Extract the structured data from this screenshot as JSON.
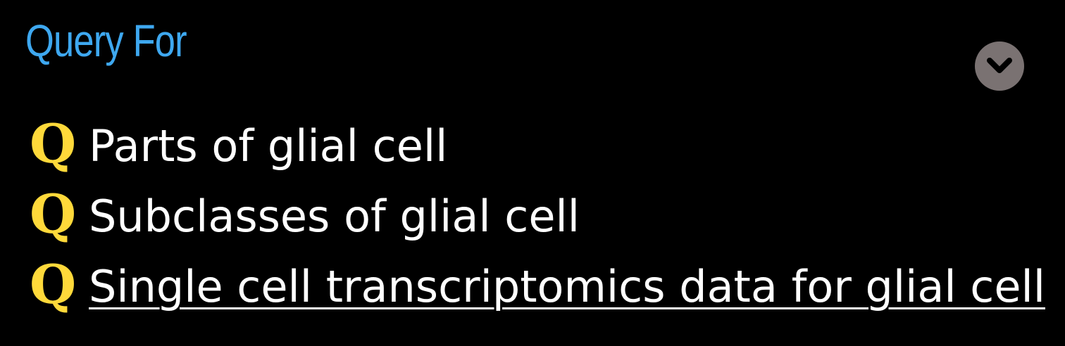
{
  "panel": {
    "title": "Query For",
    "toggle_icon": "chevron-down-icon"
  },
  "queries": [
    {
      "icon": "Q",
      "label": "Parts of glial cell",
      "link": false
    },
    {
      "icon": "Q",
      "label": "Subclasses of glial cell",
      "link": false
    },
    {
      "icon": "Q",
      "label": "Single cell transcriptomics data for glial cell",
      "link": true
    }
  ],
  "colors": {
    "background": "#000000",
    "title": "#3ea8f0",
    "icon": "#ffd93a",
    "text": "#ffffff",
    "toggle_bg": "#7a7272",
    "toggle_chevron": "#000000"
  }
}
